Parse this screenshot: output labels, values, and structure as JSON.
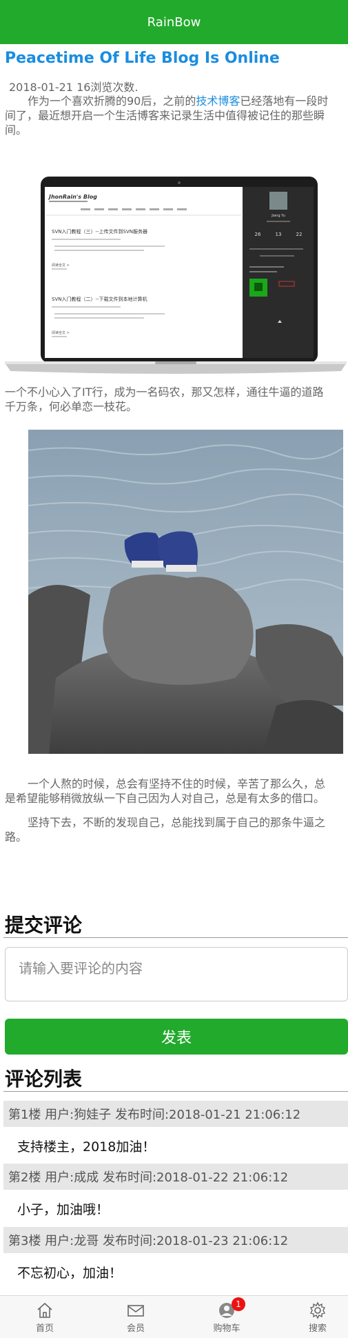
{
  "header": {
    "title": "RainBow"
  },
  "article": {
    "title": "Peacetime Of Life Blog Is Online",
    "meta": "2018-01-21 16浏览次数.",
    "p1_line1_before": "作为一个喜欢折腾的90后，之前的",
    "p1_link": "技术博客",
    "p1_line1_after": "已经落地有一段时",
    "p1_line2": "间了，最近想开启一个生活博客来记录生活中值得被记住的那些瞬",
    "p1_line3": "间。",
    "p2_line1": "一个不小心入了IT行，成为一名码农，那又怎样，通往牛逼的道路",
    "p2_line2": "千万条，何必单恋一枝花。",
    "p3_line1": "一个人熬的时候，总会有坚持不住的时候，辛苦了那么久，总",
    "p3_line2": "是希望能够稍微放纵一下自己因为人对自己，总是有太多的借口。",
    "p4_line1": "坚持下去，不断的发现自己，总能找到属于自己的那条牛逼之",
    "p4_line2": "路。"
  },
  "laptop_screen": {
    "blog_logo": "JhonRain's Blog",
    "post1_title": "SVN入门教程（三）--上传文件到SVN服务器",
    "post2_title": "SVN入门教程（二）--下载文件到本地计算机",
    "read_more": "阅读全文 >",
    "profile_name": "Jiang Yu",
    "stats": [
      "26",
      "13",
      "22"
    ]
  },
  "comment_form": {
    "heading": "提交评论",
    "placeholder": "请输入要评论的内容",
    "submit_label": "发表"
  },
  "comment_list": {
    "heading": "评论列表",
    "items": [
      {
        "head": "第1楼 用户:狗娃子 发布时间:2018-01-21 21:06:12",
        "body": "支持楼主，2018加油！"
      },
      {
        "head": "第2楼 用户:成成 发布时间:2018-01-22 21:06:12",
        "body": "小子，加油哦！"
      },
      {
        "head": "第3楼 用户:龙哥 发布时间:2018-01-23 21:06:12",
        "body": "不忘初心，加油！"
      }
    ]
  },
  "bottom_nav": {
    "items": [
      {
        "label": "首页",
        "icon": "home-icon"
      },
      {
        "label": "会员",
        "icon": "mail-icon"
      },
      {
        "label": "购物车",
        "icon": "cart-icon",
        "badge": "1"
      },
      {
        "label": "搜索",
        "icon": "gear-icon"
      }
    ]
  },
  "colors": {
    "accent": "#22aa2c",
    "link": "#1a8de0",
    "badge": "#ee1111"
  }
}
